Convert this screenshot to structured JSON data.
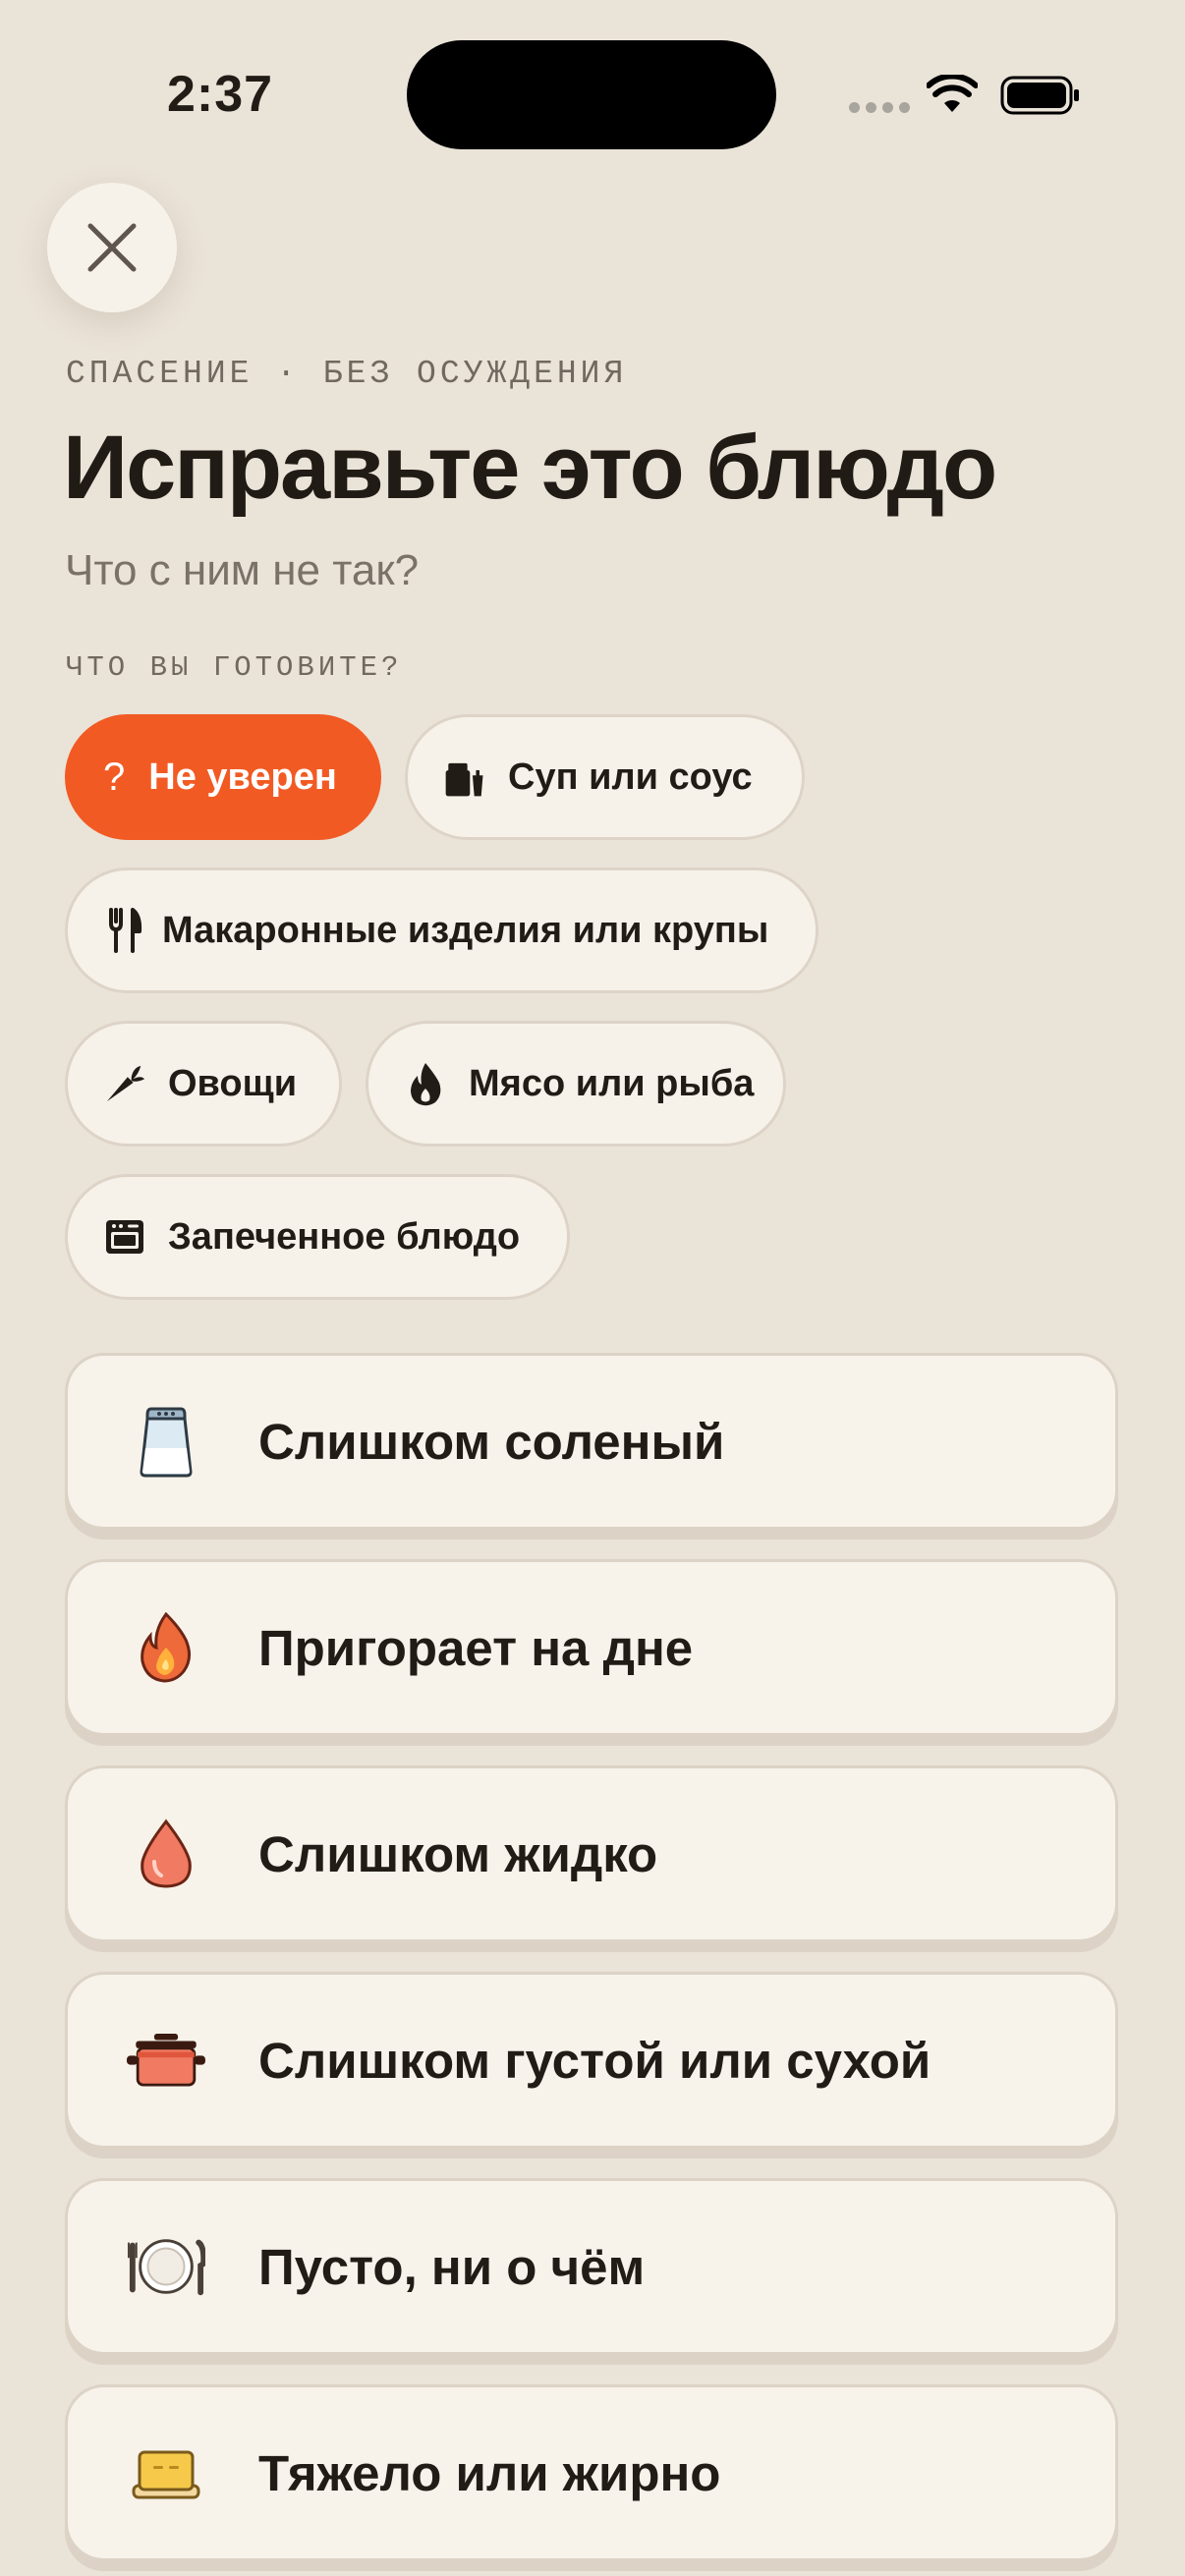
{
  "status_bar": {
    "time": "2:37"
  },
  "header": {
    "eyebrow": "СПАСЕНИЕ · БЕЗ ОСУЖДЕНИЯ",
    "title": "Исправьте это блюдо",
    "subtitle": "Что с ним не так?"
  },
  "categories": {
    "label": "ЧТО ВЫ ГОТОВИТЕ?",
    "items": [
      {
        "label": "Не уверен",
        "icon": "question-mark",
        "selected": true
      },
      {
        "label": "Суп или соус",
        "icon": "pot-icon",
        "selected": false
      },
      {
        "label": "Макаронные изделия или крупы",
        "icon": "fork-knife-icon",
        "selected": false
      },
      {
        "label": "Овощи",
        "icon": "carrot-icon",
        "selected": false
      },
      {
        "label": "Мясо или рыба",
        "icon": "flame-icon",
        "selected": false
      },
      {
        "label": "Запеченное блюдо",
        "icon": "oven-icon",
        "selected": false
      }
    ]
  },
  "problems": [
    {
      "label": "Слишком соленый",
      "icon": "salt-shaker-icon"
    },
    {
      "label": "Пригорает на дне",
      "icon": "fire-icon"
    },
    {
      "label": "Слишком жидко",
      "icon": "droplet-icon"
    },
    {
      "label": "Слишком густой или сухой",
      "icon": "cooking-pot-icon"
    },
    {
      "label": "Пусто, ни о чём",
      "icon": "plate-cutlery-icon"
    },
    {
      "label": "Тяжело или жирно",
      "icon": "butter-icon"
    }
  ],
  "colors": {
    "accent": "#F25A24",
    "background": "#EAE3D8",
    "card": "#F7F3EA",
    "text": "#221C17"
  }
}
